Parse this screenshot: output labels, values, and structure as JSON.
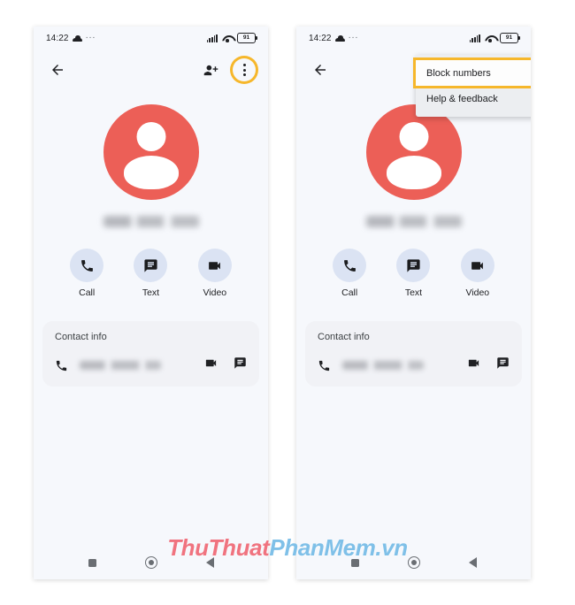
{
  "screen": {
    "background": "#ffffff",
    "panel_background": "#f6f8fc",
    "avatar_color": "#ec5f57",
    "highlight_color": "#f6b72b",
    "action_circle_color": "#dbe3f3",
    "card_color": "#f1f2f6"
  },
  "watermark": {
    "part1": "ThuThuat",
    "part2": "PhanMem",
    "part3": ".vn",
    "color1": "#f0737f",
    "color2": "#7fc0e8"
  },
  "panels": [
    {
      "id": "left",
      "status_bar": {
        "time": "14:22",
        "cloud_icon": "cloud-icon",
        "more_dots": "···",
        "signal_icon": "signal-bars-icon",
        "wifi_icon": "wifi-icon",
        "battery_level": "91"
      },
      "app_bar": {
        "back_icon": "arrow-back-icon",
        "add_person_icon": "person-add-icon",
        "overflow_icon": "more-vert-icon",
        "overflow_highlighted": true
      },
      "contact": {
        "avatar_icon": "person-avatar-icon",
        "name_redacted": true
      },
      "actions": [
        {
          "label": "Call",
          "icon": "phone-icon"
        },
        {
          "label": "Text",
          "icon": "message-icon"
        },
        {
          "label": "Video",
          "icon": "videocam-icon"
        }
      ],
      "contact_info": {
        "title": "Contact info",
        "row": {
          "lead_icon": "phone-icon",
          "number_redacted": true,
          "video_icon": "videocam-icon",
          "message_icon": "message-icon"
        }
      },
      "nav_bar": {
        "recents_icon": "square-recents-icon",
        "home_icon": "circle-home-icon",
        "back_icon": "triangle-back-icon"
      },
      "menu_open": false,
      "menu_items": []
    },
    {
      "id": "right",
      "status_bar": {
        "time": "14:22",
        "cloud_icon": "cloud-icon",
        "more_dots": "···",
        "signal_icon": "signal-bars-icon",
        "wifi_icon": "wifi-icon",
        "battery_level": "91"
      },
      "app_bar": {
        "back_icon": "arrow-back-icon",
        "add_person_icon": "person-add-icon",
        "overflow_icon": "more-vert-icon",
        "overflow_highlighted": false
      },
      "contact": {
        "avatar_icon": "person-avatar-icon",
        "name_redacted": true
      },
      "actions": [
        {
          "label": "Call",
          "icon": "phone-icon"
        },
        {
          "label": "Text",
          "icon": "message-icon"
        },
        {
          "label": "Video",
          "icon": "videocam-icon"
        }
      ],
      "contact_info": {
        "title": "Contact info",
        "row": {
          "lead_icon": "phone-icon",
          "number_redacted": true,
          "video_icon": "videocam-icon",
          "message_icon": "message-icon"
        }
      },
      "nav_bar": {
        "recents_icon": "square-recents-icon",
        "home_icon": "circle-home-icon",
        "back_icon": "triangle-back-icon"
      },
      "menu_open": true,
      "menu_items": [
        {
          "label": "Block numbers",
          "selected": true
        },
        {
          "label": "Help & feedback",
          "selected": false
        }
      ]
    }
  ]
}
